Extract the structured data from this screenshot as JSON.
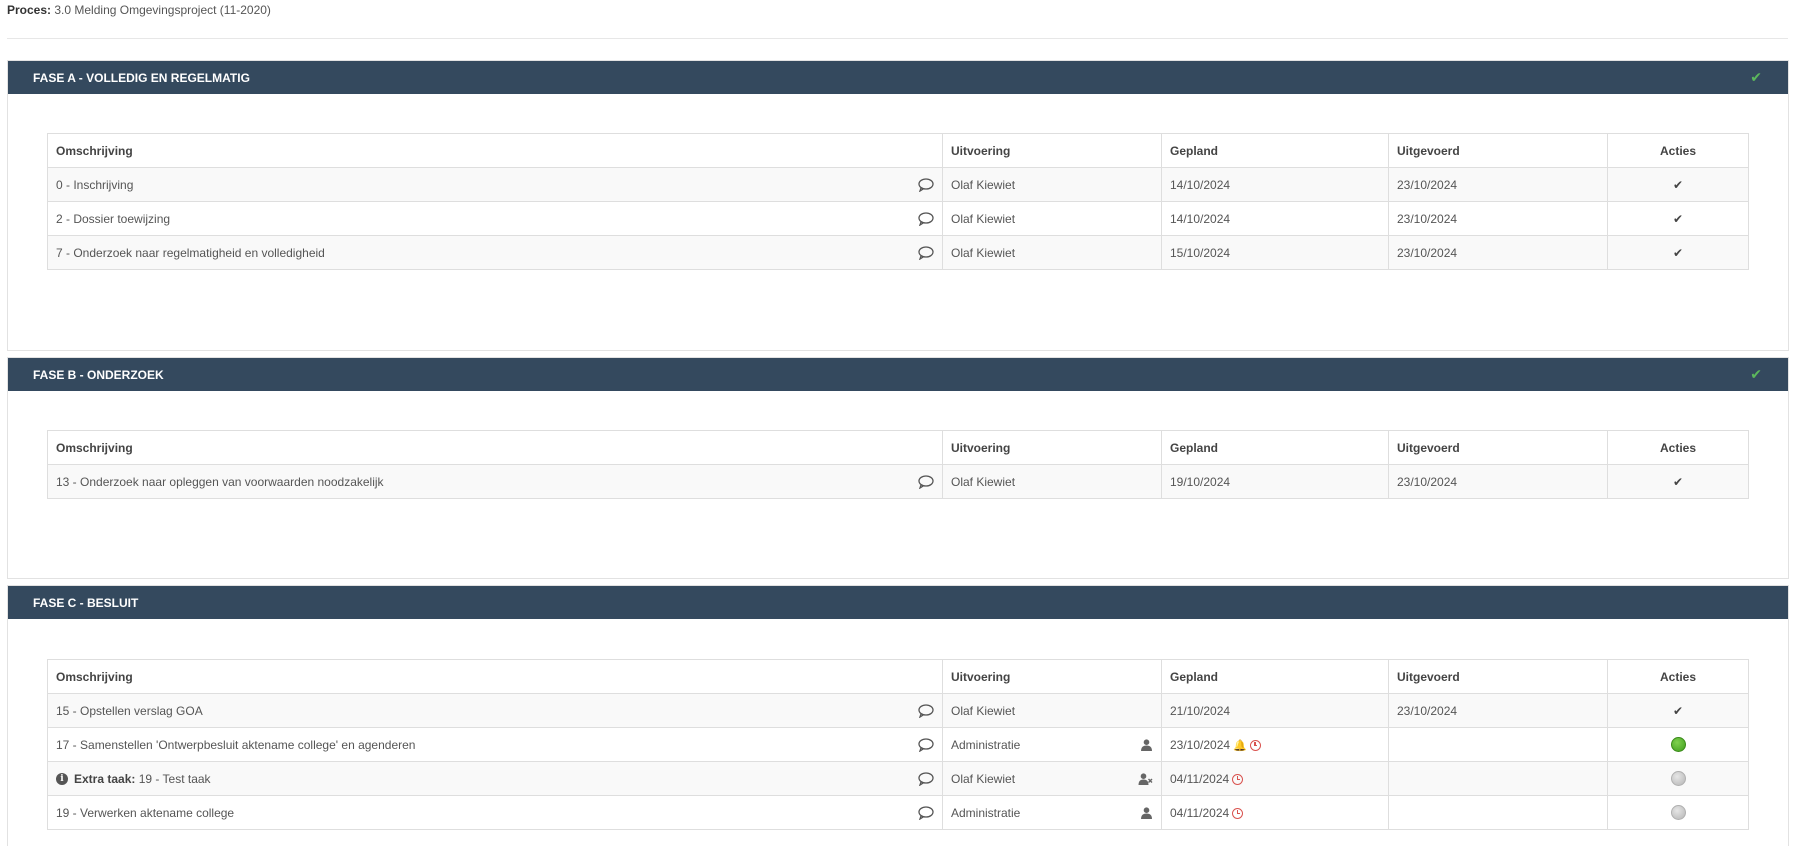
{
  "process": {
    "label": "Proces:",
    "value": "3.0 Melding Omgevingsproject (11-2020)"
  },
  "columns": {
    "description": "Omschrijving",
    "executor": "Uitvoering",
    "planned": "Gepland",
    "executed": "Uitgevoerd",
    "actions": "Acties"
  },
  "colors": {
    "header_bg": "#34495e",
    "check_green": "#5cb85c",
    "status_green": "#4caf2a",
    "status_gray": "#c4c4c4",
    "bell": "#f0ad00",
    "clock": "#d9534f"
  },
  "phases": [
    {
      "title": "FASE A - VOLLEDIG EN REGELMATIG",
      "completed": true,
      "rows": [
        {
          "description": "0 - Inschrijving",
          "executor": "Olaf Kiewiet",
          "planned": "14/10/2024",
          "executed": "23/10/2024",
          "action": "done"
        },
        {
          "description": "2 - Dossier toewijzing",
          "executor": "Olaf Kiewiet",
          "planned": "14/10/2024",
          "executed": "23/10/2024",
          "action": "done"
        },
        {
          "description": "7 - Onderzoek naar regelmatigheid en volledigheid",
          "executor": "Olaf Kiewiet",
          "planned": "15/10/2024",
          "executed": "23/10/2024",
          "action": "done"
        }
      ]
    },
    {
      "title": "FASE B - ONDERZOEK",
      "completed": true,
      "rows": [
        {
          "description": "13 - Onderzoek naar opleggen van voorwaarden noodzakelijk",
          "executor": "Olaf Kiewiet",
          "planned": "19/10/2024",
          "executed": "23/10/2024",
          "action": "done"
        }
      ]
    },
    {
      "title": "FASE C - BESLUIT",
      "completed": false,
      "rows": [
        {
          "description": "15 - Opstellen verslag GOA",
          "executor": "Olaf Kiewiet",
          "planned": "21/10/2024",
          "executed": "23/10/2024",
          "action": "done"
        },
        {
          "description": "17 - Samenstellen 'Ontwerpbesluit aktename college' en agenderen",
          "executor": "Administratie",
          "planned": "23/10/2024",
          "executed": "",
          "action": "status-green"
        },
        {
          "extra_label": "Extra taak:",
          "description": "19 - Test taak",
          "executor": "Olaf Kiewiet",
          "planned": "04/11/2024",
          "executed": "",
          "action": "status-gray"
        },
        {
          "description": "19 - Verwerken aktename college",
          "executor": "Administratie",
          "planned": "04/11/2024",
          "executed": "",
          "action": "status-gray"
        }
      ]
    }
  ]
}
